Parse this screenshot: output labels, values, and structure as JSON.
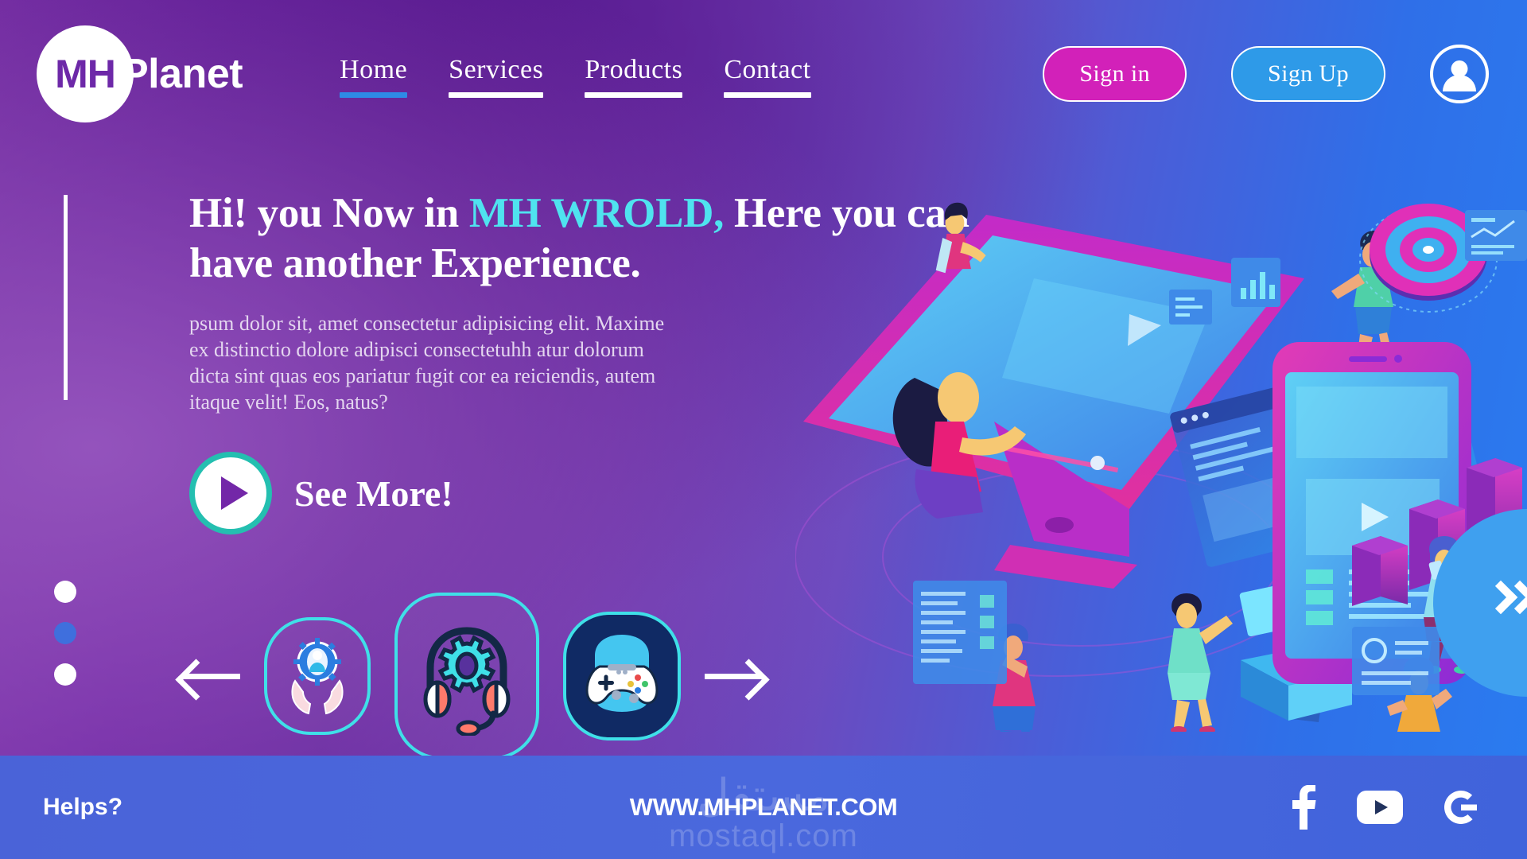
{
  "brand": {
    "mark": "MH",
    "name": "Planet"
  },
  "nav": {
    "items": [
      {
        "label": "Home",
        "active": true
      },
      {
        "label": "Services",
        "active": false
      },
      {
        "label": "Products",
        "active": false
      },
      {
        "label": "Contact",
        "active": false
      }
    ]
  },
  "auth": {
    "signin_label": "Sign in",
    "signup_label": "Sign Up",
    "avatar_icon": "user-avatar-icon"
  },
  "hero": {
    "headline_part1": "Hi! you Now in ",
    "headline_highlight": "MH WROLD,",
    "headline_part2": " Here you can have another Experience.",
    "paragraph": "psum dolor sit, amet consectetur adipisicing elit. Maxime ex distinctio dolore adipisci consectetuhh atur dolorum dicta sint quas eos pariatur fugit cor ea reiciendis, autem itaque velit! Eos, natus?",
    "cta_label": "See More!",
    "cta_icon": "play-icon",
    "slider_dots": [
      {
        "active": false
      },
      {
        "active": true
      },
      {
        "active": false
      }
    ],
    "next_icon": "double-chevron-right-icon"
  },
  "categories": {
    "prev_icon": "arrow-left-icon",
    "next_icon": "arrow-right-icon",
    "items": [
      {
        "name": "support-hands-gear-icon",
        "size": "small"
      },
      {
        "name": "headset-gear-icon",
        "size": "large"
      },
      {
        "name": "gamepad-icon",
        "size": "gamebox"
      }
    ]
  },
  "footer": {
    "help_label": "Helps?",
    "url_label": "WWW.MHPLANET.COM",
    "socials": [
      {
        "name": "facebook-icon"
      },
      {
        "name": "youtube-icon"
      },
      {
        "name": "google-icon"
      }
    ],
    "watermark_arabic": "مستقل",
    "watermark_latin": "mostaql.com"
  },
  "colors": {
    "accent_pink": "#d221b9",
    "accent_blue": "#2e9ae8",
    "highlight_cyan": "#4fe3ef",
    "active_underline": "#2e8ae6",
    "teal_ring": "#24bfb0",
    "footer_bg": "#4a63d8"
  }
}
